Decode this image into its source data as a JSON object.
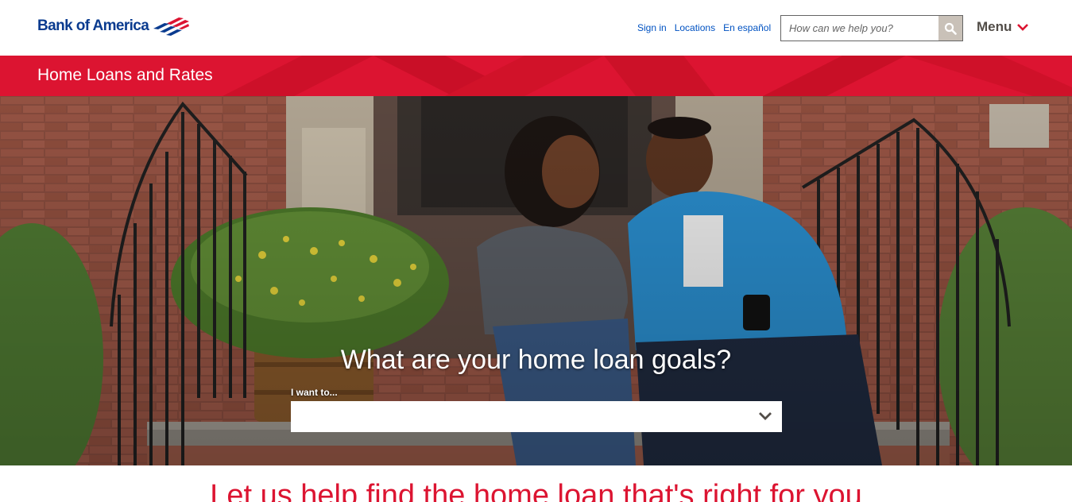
{
  "header": {
    "logo_text": "Bank of America",
    "utility_links": [
      "Sign in",
      "Locations",
      "En español"
    ],
    "search_placeholder": "How can we help you?",
    "menu_label": "Menu"
  },
  "banner": {
    "title": "Home Loans and Rates"
  },
  "hero": {
    "heading": "What are your home loan goals?",
    "select_label": "I want to...",
    "select_value": ""
  },
  "tagline": "Let us help find the home loan that's right for you",
  "colors": {
    "brand_red": "#dc1431",
    "brand_blue": "#0a3b8f",
    "link_blue": "#0052c2"
  },
  "icons": {
    "search": "search-icon",
    "menu": "chevron-down-icon",
    "select": "chevron-down-icon"
  }
}
